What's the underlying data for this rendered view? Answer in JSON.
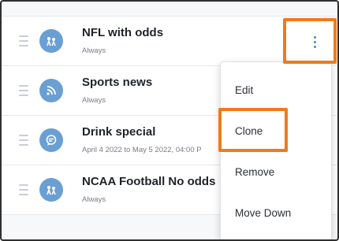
{
  "rows": [
    {
      "title": "NFL with odds",
      "schedule": "Always",
      "icon": "football-players-icon"
    },
    {
      "title": "Sports news",
      "schedule": "Always",
      "icon": "rss-feed-icon"
    },
    {
      "title": "Drink special",
      "schedule": "April 4 2022 to May 5 2022, 04:00 P",
      "icon": "speech-bubble-icon"
    },
    {
      "title": "NCAA Football  No odds",
      "schedule": "Always",
      "icon": "football-players-icon"
    }
  ],
  "menu": {
    "items": [
      "Edit",
      "Clone",
      "Remove",
      "Move Down"
    ]
  },
  "colors": {
    "accent": "#4a86c8",
    "avatar": "#6a9fd4",
    "highlight": "#f07a1a"
  }
}
